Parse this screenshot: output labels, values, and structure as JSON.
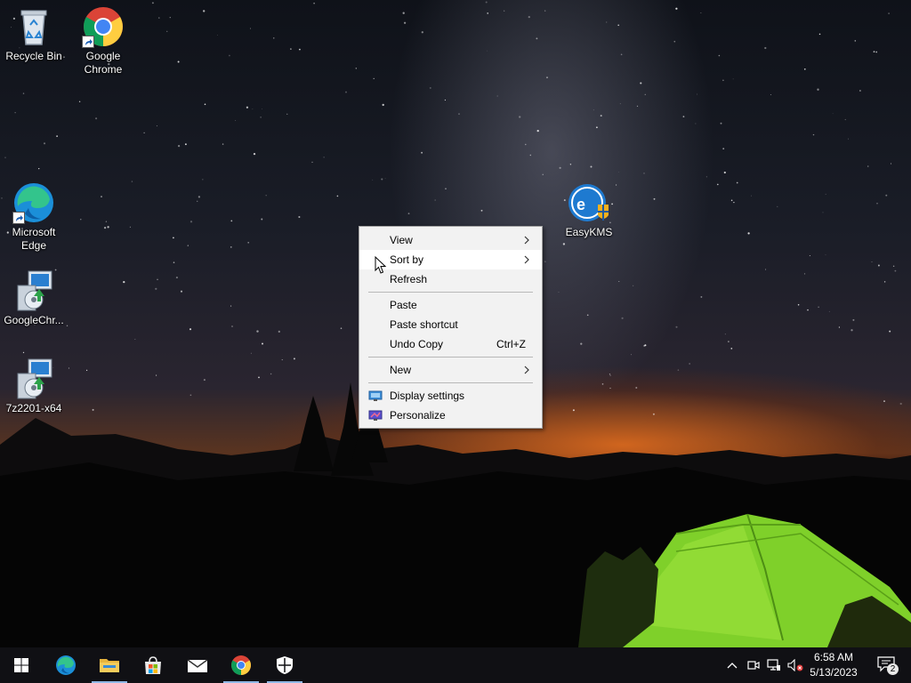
{
  "desktop": {
    "icons": [
      {
        "label": "Recycle Bin",
        "icon": "recycle-bin-icon"
      },
      {
        "label": "Google\nChrome",
        "icon": "chrome-icon"
      },
      {
        "label": "Microsoft\nEdge",
        "icon": "edge-icon"
      },
      {
        "label": "GoogleChr...",
        "icon": "installer-icon"
      },
      {
        "label": "7z2201-x64",
        "icon": "installer-icon"
      },
      {
        "label": "EasyKMS",
        "icon": "easykms-icon"
      }
    ]
  },
  "context_menu": {
    "items": [
      {
        "label": "View",
        "has_submenu": true
      },
      {
        "label": "Sort by",
        "has_submenu": true,
        "highlighted": true
      },
      {
        "label": "Refresh"
      },
      {
        "label": "Paste"
      },
      {
        "label": "Paste shortcut"
      },
      {
        "label": "Undo Copy",
        "shortcut": "Ctrl+Z"
      },
      {
        "label": "New",
        "has_submenu": true
      },
      {
        "label": "Display settings",
        "icon": "display-settings-icon"
      },
      {
        "label": "Personalize",
        "icon": "personalize-icon"
      }
    ]
  },
  "taskbar": {
    "pinned": [
      {
        "name": "start-button",
        "icon": "windows-logo-icon"
      },
      {
        "name": "edge",
        "icon": "edge-icon"
      },
      {
        "name": "file-explorer",
        "icon": "folder-icon",
        "running": true
      },
      {
        "name": "microsoft-store",
        "icon": "store-icon"
      },
      {
        "name": "mail",
        "icon": "mail-icon"
      },
      {
        "name": "chrome",
        "icon": "chrome-icon",
        "running": true
      },
      {
        "name": "windows-security",
        "icon": "shield-icon"
      }
    ],
    "tray_icons": [
      "chevron-up-icon",
      "meet-now-icon",
      "network-icon",
      "volume-muted-icon"
    ],
    "clock": {
      "time": "6:58 AM",
      "date": "5/13/2023"
    },
    "notifications": {
      "count": "2"
    }
  },
  "colors": {
    "menu_bg": "#f2f2f2",
    "menu_highlight": "#ffffff",
    "taskbar_bg": "#101014",
    "running_indicator": "#8fb8e6"
  }
}
